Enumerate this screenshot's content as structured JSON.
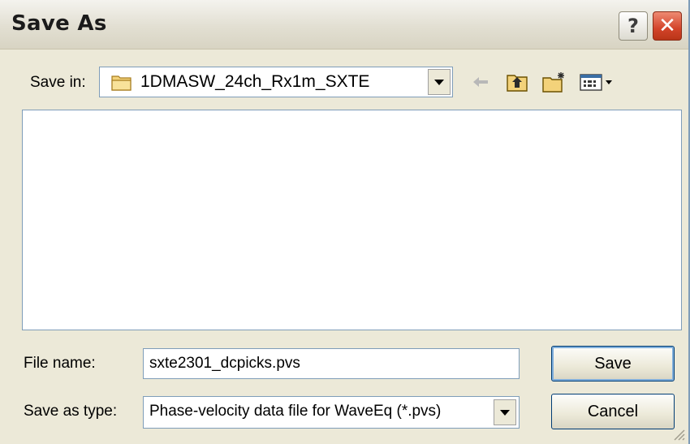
{
  "window": {
    "title": "Save As",
    "help_label": "?",
    "close_label": "✕"
  },
  "save_in": {
    "label": "Save in:",
    "value": "1DMASW_24ch_Rx1m_SXTE"
  },
  "toolbar": {
    "icons": [
      "back-arrow-icon",
      "up-one-level-icon",
      "create-new-folder-icon",
      "view-menu-icon"
    ]
  },
  "file_list": {
    "items": []
  },
  "file_name": {
    "label": "File name:",
    "value": "sxte2301_dcpicks.pvs"
  },
  "save_as_type": {
    "label": "Save as type:",
    "value": "Phase-velocity data file for WaveEq (*.pvs)"
  },
  "buttons": {
    "save": "Save",
    "cancel": "Cancel"
  },
  "colors": {
    "dialog_bg": "#ece9d8",
    "field_border": "#7f9db9",
    "close_red": "#d3442a"
  }
}
